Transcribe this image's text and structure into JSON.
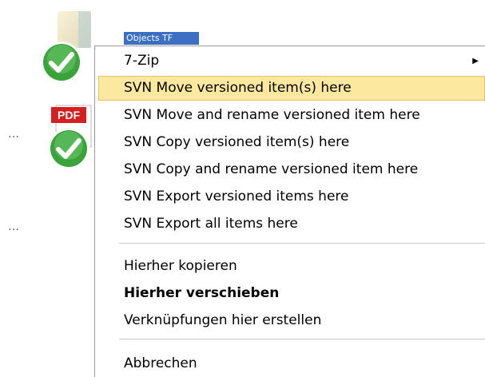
{
  "desktop": {
    "selected_label": "Objects TF",
    "pdf_badge": "PDF",
    "dots_1": "…",
    "dots_2": "…"
  },
  "context_menu": {
    "items": [
      {
        "label": "7-Zip",
        "submenu": true
      },
      {
        "label": "SVN Move versioned item(s) here",
        "highlighted": true
      },
      {
        "label": "SVN Move and rename versioned item here"
      },
      {
        "label": "SVN Copy versioned item(s) here"
      },
      {
        "label": "SVN Copy and rename versioned item here"
      },
      {
        "label": "SVN Export versioned items here"
      },
      {
        "label": "SVN Export all items here"
      },
      {
        "label": "Hierher kopieren"
      },
      {
        "label": "Hierher verschieben",
        "bold": true
      },
      {
        "label": "Verknüpfungen hier erstellen"
      },
      {
        "label": "Abbrechen"
      }
    ],
    "submenu_arrow": "▶"
  },
  "colors": {
    "highlight_bg": "#fde8a0",
    "highlight_border": "#e5c365",
    "check_green": "#3aa33a",
    "pdf_red": "#d42020",
    "selection_blue": "#3a6fc4"
  }
}
